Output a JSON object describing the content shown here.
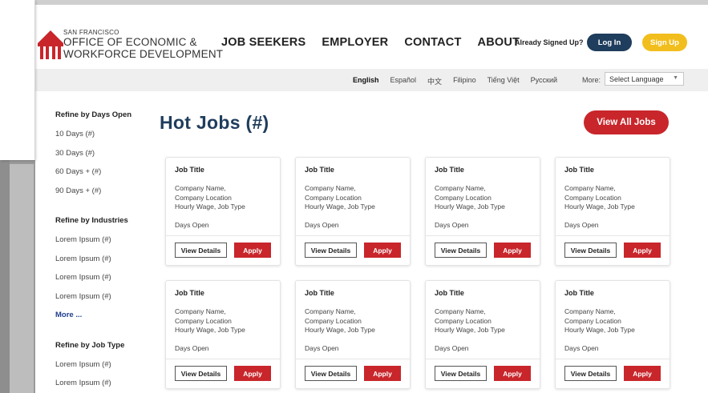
{
  "header": {
    "logo_small": "SAN FRANCISCO",
    "logo_line1": "OFFICE OF ECONOMIC &",
    "logo_line2": "WORKFORCE DEVELOPMENT",
    "nav": [
      {
        "label": "JOB SEEKERS"
      },
      {
        "label": "EMPLOYER"
      },
      {
        "label": "CONTACT"
      },
      {
        "label": "ABOUT"
      }
    ],
    "signed_text": "Already Signed Up?",
    "login_label": "Log In",
    "signup_label": "Sign Up",
    "colors": {
      "login_bg": "#1f3d5c",
      "signup_bg": "#f2be1d",
      "logo_red": "#c8262b"
    }
  },
  "languages": {
    "items": [
      "English",
      "Español",
      "中文",
      "Filipino",
      "Tiếng Việt",
      "Русский"
    ],
    "active": "English",
    "more_label": "More:",
    "select_value": "Select Language"
  },
  "sidebar": {
    "sections": [
      {
        "heading": "Refine by Days Open",
        "items": [
          "10 Days (#)",
          "30 Days (#)",
          "60 Days + (#)",
          "90 Days + (#)"
        ]
      },
      {
        "heading": "Refine by Industries",
        "items": [
          "Lorem Ipsum (#)",
          "Lorem Ipsum (#)",
          "Lorem Ipsum (#)",
          "Lorem Ipsum (#)"
        ],
        "more": "More ..."
      },
      {
        "heading": "Refine by Job Type",
        "items": [
          "Lorem Ipsum (#)",
          "Lorem Ipsum (#)"
        ]
      }
    ]
  },
  "main": {
    "title": "Hot Jobs (#)",
    "view_all_label": "View All Jobs",
    "accent_color": "#c8262b",
    "title_color": "#1f3d5c",
    "cards": [
      {
        "title": "Job Title",
        "line1": "Company Name,",
        "line2": "Company Location",
        "line3": "Hourly Wage, Job Type",
        "days": "Days Open",
        "details_label": "View Details",
        "apply_label": "Apply"
      },
      {
        "title": "Job Title",
        "line1": "Company Name,",
        "line2": "Company Location",
        "line3": "Hourly Wage, Job Type",
        "days": "Days Open",
        "details_label": "View Details",
        "apply_label": "Apply"
      },
      {
        "title": "Job Title",
        "line1": "Company Name,",
        "line2": "Company Location",
        "line3": "Hourly Wage, Job Type",
        "days": "Days Open",
        "details_label": "View Details",
        "apply_label": "Apply"
      },
      {
        "title": "Job Title",
        "line1": "Company Name,",
        "line2": "Company Location",
        "line3": "Hourly Wage, Job Type",
        "days": "Days Open",
        "details_label": "View Details",
        "apply_label": "Apply"
      },
      {
        "title": "Job Title",
        "line1": "Company Name,",
        "line2": "Company Location",
        "line3": "Hourly Wage, Job Type",
        "days": "Days Open",
        "details_label": "View Details",
        "apply_label": "Apply"
      },
      {
        "title": "Job Title",
        "line1": "Company Name,",
        "line2": "Company Location",
        "line3": "Hourly Wage, Job Type",
        "days": "Days Open",
        "details_label": "View Details",
        "apply_label": "Apply"
      },
      {
        "title": "Job Title",
        "line1": "Company Name,",
        "line2": "Company Location",
        "line3": "Hourly Wage, Job Type",
        "days": "Days Open",
        "details_label": "View Details",
        "apply_label": "Apply"
      },
      {
        "title": "Job Title",
        "line1": "Company Name,",
        "line2": "Company Location",
        "line3": "Hourly Wage, Job Type",
        "days": "Days Open",
        "details_label": "View Details",
        "apply_label": "Apply"
      }
    ]
  }
}
